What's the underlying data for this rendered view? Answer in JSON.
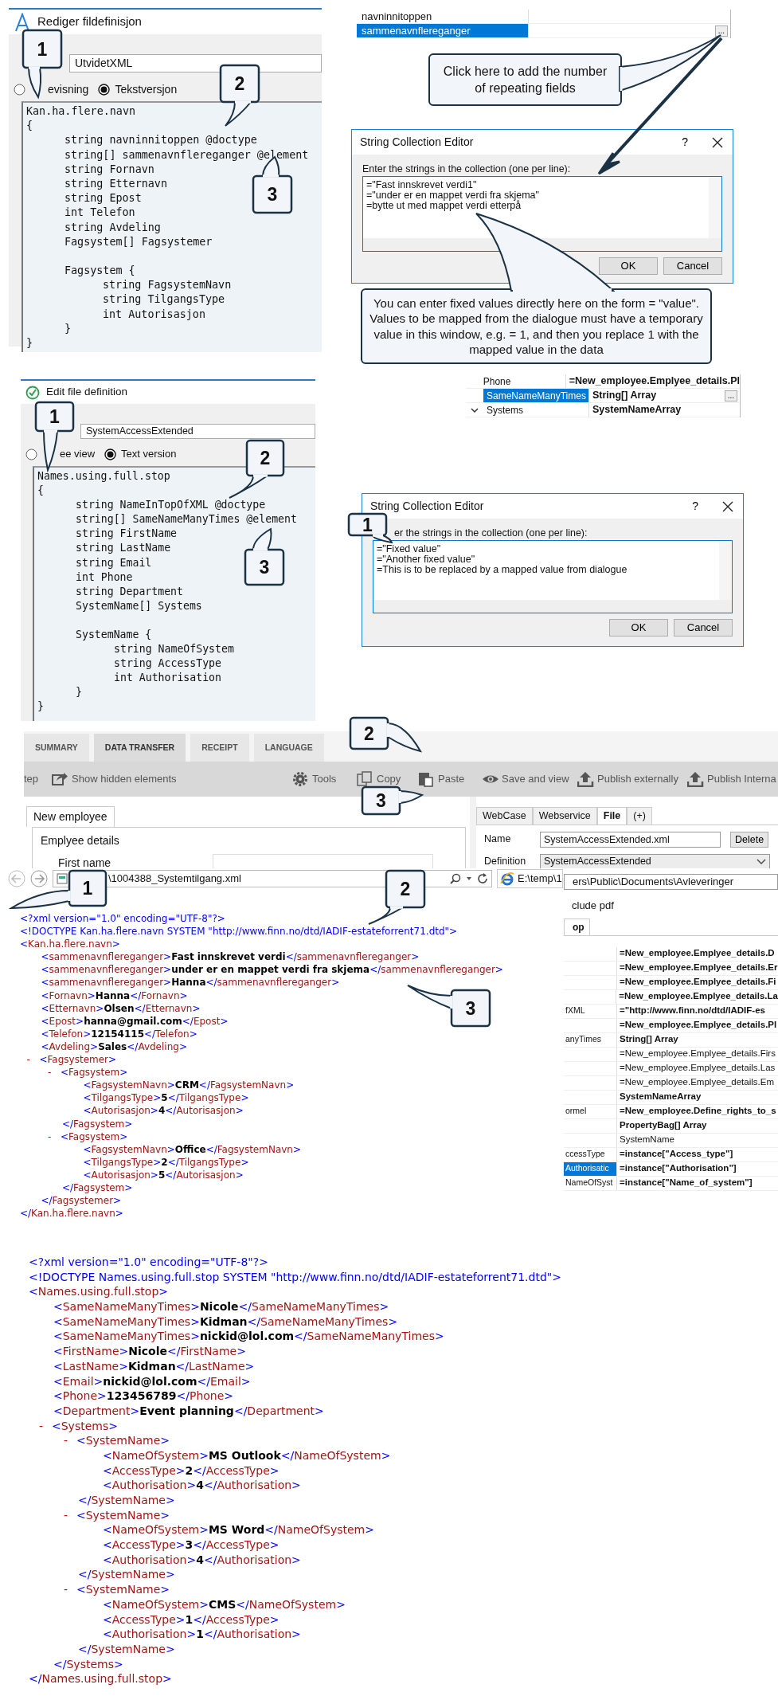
{
  "definition_editor_no": {
    "title": "Rediger fildefinisjon",
    "name_value": "UtvidetXML",
    "view_options": [
      {
        "label": "evisning",
        "selected": false
      },
      {
        "label": "Tekstversjon",
        "selected": true
      }
    ],
    "code": [
      {
        "text": "Kan.ha.flere.navn"
      },
      {
        "text": "{",
        "children": [
          {
            "text": "string navninnitoppen @doctype"
          },
          {
            "text": "string[] sammenavnflereganger @element"
          },
          {
            "text": "string Fornavn"
          },
          {
            "text": "string Etternavn"
          },
          {
            "text": "string Epost"
          },
          {
            "text": "int Telefon"
          },
          {
            "text": "string Avdeling"
          },
          {
            "text": "Fagsystem[] Fagsystemer"
          },
          {
            "kind": "blank"
          },
          {
            "text": "Fagsystem {",
            "children": [
              {
                "text": "string FagsystemNavn"
              },
              {
                "text": "string TilgangsType"
              },
              {
                "text": "int Autorisasjon"
              }
            ]
          },
          {
            "text": "}"
          }
        ]
      },
      {
        "text": "}"
      }
    ],
    "callouts": [
      {
        "text": "1"
      },
      {
        "text": "2"
      },
      {
        "text": "3"
      }
    ]
  },
  "property_grid_no": {
    "rows": [
      {
        "name": "navninnitoppen",
        "selected": false
      },
      {
        "name": "sammenavnflereganger",
        "selected": true,
        "button": "..."
      }
    ]
  },
  "hint_callout": {
    "text": "Click here to add the number of repeating fields"
  },
  "collection_editor_no": {
    "title": "String Collection Editor",
    "help": "?",
    "label": "Enter the strings in the collection (one per line):",
    "lines": [
      "=\"Fast innskrevet verdi1\"",
      "=\"under er en mappet verdi fra skjema\"",
      "=bytte ut med mappet verdi etterpå"
    ],
    "buttons": [
      "OK",
      "Cancel"
    ]
  },
  "explain_callout": {
    "text": "You can enter fixed values directly here on the form = \"value\". Values to be mapped from the dialogue must have a temporary value in this window, e.g. = 1, and then you replace 1 with the mapped value in the data"
  },
  "definition_editor_en": {
    "title": "Edit file definition",
    "name_value": "SystemAccessExtended",
    "view_options": [
      {
        "label": "ee view",
        "selected": false
      },
      {
        "label": "Text version",
        "selected": true
      }
    ],
    "code": [
      {
        "text": "Names.using.full.stop"
      },
      {
        "text": "{",
        "children": [
          {
            "text": "string NameInTopOfXML @doctype"
          },
          {
            "text": "string[] SameNameManyTimes @element"
          },
          {
            "text": "string FirstName"
          },
          {
            "text": "string LastName"
          },
          {
            "text": "string Email"
          },
          {
            "text": "int Phone"
          },
          {
            "text": "string Department"
          },
          {
            "text": "SystemName[] Systems"
          },
          {
            "kind": "blank"
          },
          {
            "text": "SystemName {",
            "children": [
              {
                "text": "string NameOfSystem"
              },
              {
                "text": "string AccessType"
              },
              {
                "text": "int Authorisation"
              }
            ]
          },
          {
            "text": "}"
          }
        ]
      },
      {
        "text": "}"
      }
    ],
    "callouts": [
      {
        "text": "1"
      },
      {
        "text": "2"
      },
      {
        "text": "3"
      }
    ]
  },
  "property_grid_en": {
    "rows": [
      {
        "kind": "property",
        "name": "Phone",
        "value": "=New_employee.Emplyee_details.Pl",
        "selected": false
      },
      {
        "kind": "property",
        "name": "SameNameManyTimes",
        "value": "String[] Array",
        "selected": true,
        "button": "..."
      },
      {
        "kind": "group",
        "name": "Systems",
        "value": "SystemNameArray",
        "selected": false,
        "expanded": true
      }
    ]
  },
  "collection_editor_en": {
    "title": "String Collection Editor",
    "help": "?",
    "label": "er the strings in the collection (one per line):",
    "lines": [
      "=\"Fixed value\"",
      "=\"Another fixed value\"",
      "=This is to be replaced by a mapped value from dialogue"
    ],
    "buttons": [
      "OK",
      "Cancel"
    ],
    "callouts": [
      {
        "text": "1"
      }
    ]
  },
  "designer": {
    "tabs": [
      {
        "label": "SUMMARY",
        "selected": false
      },
      {
        "label": "DATA TRANSFER",
        "selected": true
      },
      {
        "label": "RECEIPT",
        "selected": false
      },
      {
        "label": "LANGUAGE",
        "selected": false
      }
    ],
    "toolbar": [
      {
        "label": "tep",
        "kind": "text"
      },
      {
        "label": "Show hidden elements",
        "kind": "share"
      },
      {
        "label": "Tools",
        "kind": "gear"
      },
      {
        "label": "Copy",
        "kind": "copy"
      },
      {
        "label": "Paste",
        "kind": "paste"
      },
      {
        "label": "Save and view",
        "kind": "eye"
      },
      {
        "label": "Publish externally",
        "kind": "upload"
      },
      {
        "label": "Publish Interna",
        "kind": "upload"
      }
    ],
    "form_tab": "New employee",
    "group_title": "Emplyee details",
    "field_label": "First name",
    "side_tabs": [
      {
        "label": "WebCase",
        "selected": false
      },
      {
        "label": "Webservice",
        "selected": false
      },
      {
        "label": "File",
        "selected": true
      },
      {
        "label": "(+)",
        "selected": false
      }
    ],
    "name_label": "Name",
    "name_value": "SystemAccessExtended.xml",
    "delete_button": "Delete",
    "definition_label": "Definition",
    "definition_value": "SystemAccessExtended",
    "callouts": [
      {
        "text": "2"
      },
      {
        "text": "3"
      }
    ]
  },
  "browser": {
    "address": "\\1004388_Systemtilgang.xml",
    "tab": "E:\\temp\\1",
    "xml": [
      {
        "kind": "declaration",
        "text": "<?xml version=\"1.0\" encoding=\"UTF-8\"?>"
      },
      {
        "kind": "declaration",
        "text": "<!DOCTYPE Kan.ha.flere.navn SYSTEM \"http://www.finn.no/dtd/IADIF-estateforrent71.dtd\">"
      },
      {
        "kind": "element",
        "text": "<Kan.ha.flere.navn>",
        "close": "</Kan.ha.flere.navn>",
        "children": [
          {
            "kind": "element",
            "text": "<sammenavnflereganger>Fast innskrevet verdi</sammenavnflereganger>"
          },
          {
            "kind": "element",
            "text": "<sammenavnflereganger>under er en mappet verdi fra skjema</sammenavnflereganger>"
          },
          {
            "kind": "element",
            "text": "<sammenavnflereganger>Hanna</sammenavnflereganger>"
          },
          {
            "kind": "element",
            "text": "<Fornavn>Hanna</Fornavn>"
          },
          {
            "kind": "element",
            "text": "<Etternavn>Olsen</Etternavn>"
          },
          {
            "kind": "element",
            "text": "<Epost>hanna@gmail.com</Epost>"
          },
          {
            "kind": "element",
            "text": "<Telefon>12154115</Telefon>"
          },
          {
            "kind": "element",
            "text": "<Avdeling>Sales</Avdeling>"
          },
          {
            "kind": "element",
            "text": "<Fagsystemer>",
            "toggle": "-",
            "close": "</Fagsystemer>",
            "children": [
              {
                "kind": "element",
                "text": "<Fagsystem>",
                "toggle": "-",
                "close": "</Fagsystem>",
                "children": [
                  {
                    "kind": "element",
                    "text": "<FagsystemNavn>CRM</FagsystemNavn>"
                  },
                  {
                    "kind": "element",
                    "text": "<TilgangsType>5</TilgangsType>"
                  },
                  {
                    "kind": "element",
                    "text": "<Autorisasjon>4</Autorisasjon>"
                  }
                ]
              },
              {
                "kind": "element",
                "text": "<Fagsystem>",
                "toggle": "-",
                "close": "</Fagsystem>",
                "children": [
                  {
                    "kind": "element",
                    "text": "<FagsystemNavn>Office</FagsystemNavn>"
                  },
                  {
                    "kind": "element",
                    "text": "<TilgangsType>2</TilgangsType>"
                  },
                  {
                    "kind": "element",
                    "text": "<Autorisasjon>5</Autorisasjon>"
                  }
                ]
              }
            ]
          }
        ]
      }
    ],
    "callouts": [
      {
        "text": "1"
      },
      {
        "text": "2"
      },
      {
        "text": "3"
      }
    ]
  },
  "settings_panel": {
    "path": "ers\\Public\\Documents\\Avleveringer",
    "checkbox_label": "clude pdf",
    "tab": "op",
    "rows": [
      {
        "value": "=New_employee.Emplyee_details.D",
        "modified": true,
        "selected": false
      },
      {
        "value": "=New_employee.Emplyee_details.Er",
        "modified": true,
        "selected": false
      },
      {
        "value": "=New_employee.Emplyee_details.Fi",
        "modified": true,
        "selected": false
      },
      {
        "value": "=New_employee.Emplyee_details.La",
        "modified": true,
        "selected": false
      },
      {
        "name": "fXML",
        "value": "=\"http://www.finn.no/dtd/IADIF-es",
        "modified": true,
        "selected": false
      },
      {
        "value": "=New_employee.Emplyee_details.Pl",
        "modified": true,
        "selected": false
      },
      {
        "name": "anyTimes",
        "value": "String[] Array",
        "modified": true,
        "selected": false
      },
      {
        "value": "=New_employee.Emplyee_details.Firs",
        "modified": false,
        "selected": false
      },
      {
        "value": "=New_employee.Emplyee_details.Las",
        "modified": false,
        "selected": false
      },
      {
        "value": "=New_employee.Emplyee_details.Em",
        "modified": false,
        "selected": false
      },
      {
        "value": "SystemNameArray",
        "modified": true,
        "selected": false
      },
      {
        "name": "ormel",
        "value": "=New_employee.Define_rights_to_s",
        "modified": true,
        "selected": false
      },
      {
        "value": "PropertyBag[] Array",
        "modified": true,
        "selected": false
      },
      {
        "value": "SystemName",
        "modified": false,
        "selected": false
      },
      {
        "name": "ccessType",
        "value": "=instance[\"Access_type\"]",
        "modified": true,
        "selected": false
      },
      {
        "name": "Authorisatic",
        "value": "=instance[\"Authorisation\"]",
        "modified": true,
        "selected": true
      },
      {
        "name": "NameOfSyst",
        "value": "=instance[\"Name_of_system\"]",
        "modified": true,
        "selected": false
      }
    ]
  },
  "result_xml": [
    {
      "kind": "declaration",
      "text": "<?xml version=\"1.0\" encoding=\"UTF-8\"?>"
    },
    {
      "kind": "declaration",
      "text": "<!DOCTYPE Names.using.full.stop SYSTEM \"http://www.finn.no/dtd/IADIF-estateforrent71.dtd\">"
    },
    {
      "kind": "element",
      "text": "<Names.using.full.stop>",
      "close": "</Names.using.full.stop>",
      "children": [
        {
          "kind": "element",
          "text": "<SameNameManyTimes>Nicole</SameNameManyTimes>"
        },
        {
          "kind": "element",
          "text": "<SameNameManyTimes>Kidman</SameNameManyTimes>"
        },
        {
          "kind": "element",
          "text": "<SameNameManyTimes>nickid@lol.com</SameNameManyTimes>"
        },
        {
          "kind": "element",
          "text": "<FirstName>Nicole</FirstName>"
        },
        {
          "kind": "element",
          "text": "<LastName>Kidman</LastName>"
        },
        {
          "kind": "element",
          "text": "<Email>nickid@lol.com</Email>"
        },
        {
          "kind": "element",
          "text": "<Phone>123456789</Phone>"
        },
        {
          "kind": "element",
          "text": "<Department>Event planning</Department>"
        },
        {
          "kind": "element",
          "text": "<Systems>",
          "toggle": "-",
          "close": "</Systems>",
          "children": [
            {
              "kind": "element",
              "text": "<SystemName>",
              "toggle": "-",
              "close": "</SystemName>",
              "children": [
                {
                  "kind": "element",
                  "text": "<NameOfSystem>MS Outlook</NameOfSystem>"
                },
                {
                  "kind": "element",
                  "text": "<AccessType>2</AccessType>"
                },
                {
                  "kind": "element",
                  "text": "<Authorisation>4</Authorisation>"
                }
              ]
            },
            {
              "kind": "element",
              "text": "<SystemName>",
              "toggle": "-",
              "close": "</SystemName>",
              "children": [
                {
                  "kind": "element",
                  "text": "<NameOfSystem>MS Word</NameOfSystem>"
                },
                {
                  "kind": "element",
                  "text": "<AccessType>3</AccessType>"
                },
                {
                  "kind": "element",
                  "text": "<Authorisation>4</Authorisation>"
                }
              ]
            },
            {
              "kind": "element",
              "text": "<SystemName>",
              "toggle": "-",
              "close": "</SystemName>",
              "children": [
                {
                  "kind": "element",
                  "text": "<NameOfSystem>CMS</NameOfSystem>"
                },
                {
                  "kind": "element",
                  "text": "<AccessType>1</AccessType>"
                },
                {
                  "kind": "element",
                  "text": "<Authorisation>1</Authorisation>"
                }
              ]
            }
          ]
        }
      ]
    }
  ]
}
